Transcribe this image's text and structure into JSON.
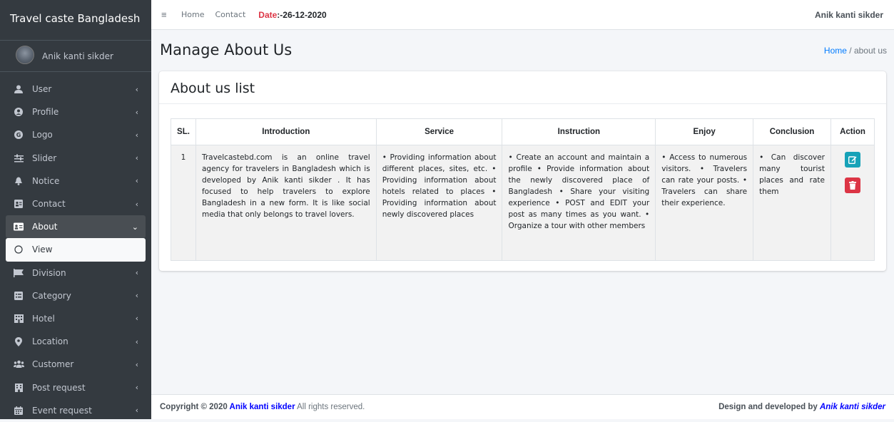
{
  "brand": "Travel caste Bangladesh",
  "user": {
    "name": "Anik kanti sikder"
  },
  "sidebar": {
    "items": [
      {
        "label": "User",
        "icon": "user-icon"
      },
      {
        "label": "Profile",
        "icon": "profile-icon"
      },
      {
        "label": "Logo",
        "icon": "logo-icon"
      },
      {
        "label": "Slider",
        "icon": "slider-icon"
      },
      {
        "label": "Notice",
        "icon": "bell-icon"
      },
      {
        "label": "Contact",
        "icon": "contact-icon"
      },
      {
        "label": "About",
        "icon": "about-icon"
      },
      {
        "label": "View",
        "icon": "circle-icon"
      },
      {
        "label": "Division",
        "icon": "flag-icon"
      },
      {
        "label": "Category",
        "icon": "category-icon"
      },
      {
        "label": "Hotel",
        "icon": "hotel-icon"
      },
      {
        "label": "Location",
        "icon": "location-icon"
      },
      {
        "label": "Customer",
        "icon": "users-icon"
      },
      {
        "label": "Post request",
        "icon": "building-icon"
      },
      {
        "label": "Event request",
        "icon": "calendar-icon"
      }
    ]
  },
  "topbar": {
    "home": "Home",
    "contact": "Contact",
    "date_label": "Date",
    "date_value": ":-26-12-2020",
    "user": "Anik kanti sikder"
  },
  "header": {
    "title": "Manage About Us",
    "breadcrumb_home": "Home",
    "breadcrumb_sep": " / ",
    "breadcrumb_current": "about us"
  },
  "card": {
    "title": "About us list"
  },
  "table": {
    "headers": [
      "SL.",
      "Introduction",
      "Service",
      "Instruction",
      "Enjoy",
      "Conclusion",
      "Action"
    ],
    "rows": [
      {
        "sl": "1",
        "introduction": "Travelcastebd.com is an online travel agency for travelers in Bangladesh which is developed by Anik kanti sikder . It has focused to help travelers to explore Bangladesh in a new form. It is like social media that only belongs to travel lovers.",
        "service": "• Providing information about different places, sites, etc. • Providing information about hotels related to places • Providing information about newly discovered places",
        "instruction": "• Create an account and maintain a profile • Provide information about the newly discovered place of Bangladesh • Share your visiting experience • POST and EDIT your post as many times as you want. • Organize a tour with other members",
        "enjoy": "• Access to numerous visitors. • Travelers can rate your posts. • Travelers can share their experience.",
        "conclusion": "• Can discover many tourist places and rate them"
      }
    ]
  },
  "footer": {
    "copyright": "Copyright © 2020 ",
    "name": "Anik kanti sikder",
    "rights": " All rights reserved.",
    "designed": "Design and developed by ",
    "designer": "Anik kanti sikder"
  },
  "colors": {
    "sidebar": "#343a40",
    "accent": "#007bff",
    "edit": "#17a2b8",
    "delete": "#dc3545"
  }
}
